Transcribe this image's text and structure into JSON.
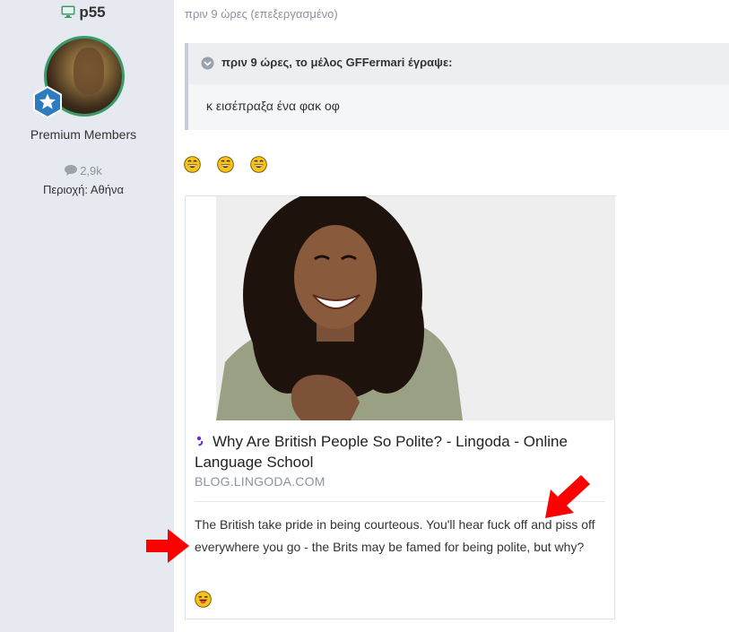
{
  "user": {
    "username": "p55",
    "member_title": "Premium Members",
    "message_count": "2,9k",
    "location": "Περιοχή: Αθήνα",
    "online_icon": "monitor-icon",
    "badge_icon": "star-badge-icon"
  },
  "post": {
    "time": "πριν 9 ώρες (επεξεργασμένο)",
    "quote": {
      "header": "πριν 9 ώρες, το μέλος GFFermari έγραψε:",
      "text": "κ εισέπραξα ένα φακ οφ"
    },
    "smilies": [
      "laughing-smiley-icon",
      "laughing-smiley-icon",
      "laughing-smiley-icon"
    ]
  },
  "link_card": {
    "title": "Why Are British People So Polite? - Lingoda - Online Language School",
    "domain": "BLOG.LINGODA.COM",
    "description": "The British take pride in being courteous. You'll hear fuck off and piss off everywhere you go - the Brits may be famed for being polite, but why?",
    "favicon": "lingoda-favicon-icon",
    "footer_smiley": "tongue-smiley-icon"
  },
  "colors": {
    "sidebar_bg": "#e6e9f0",
    "online_green": "#3a9a6a",
    "badge_blue": "#2f7bbf",
    "arrow_red": "#ff0000"
  }
}
